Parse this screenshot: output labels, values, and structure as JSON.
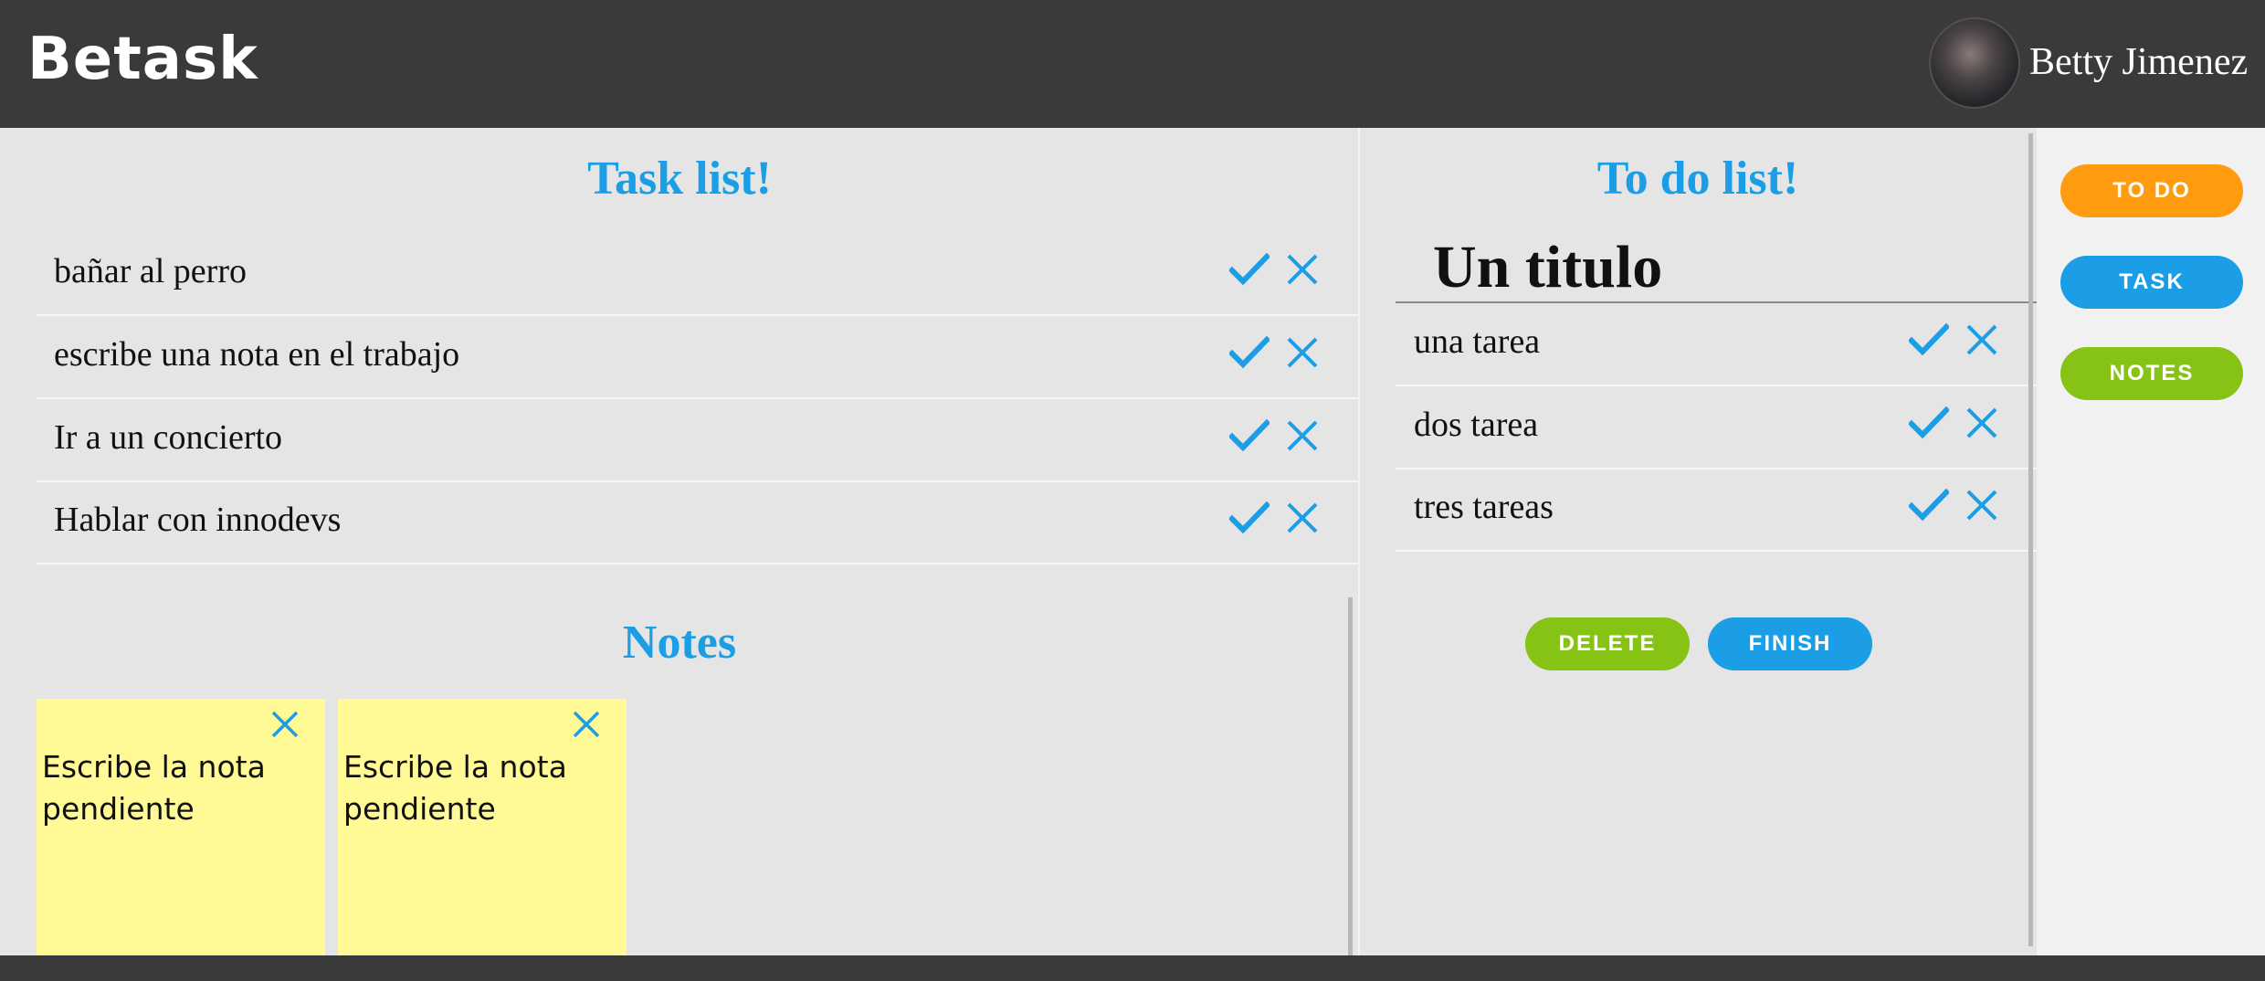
{
  "app": {
    "brand": "Betask"
  },
  "user": {
    "name": "Betty Jimenez"
  },
  "task_list": {
    "title": "Task list!",
    "items": [
      {
        "label": "bañar al perro"
      },
      {
        "label": "escribe una nota en el trabajo"
      },
      {
        "label": "Ir a un concierto"
      },
      {
        "label": "Hablar con innodevs"
      }
    ]
  },
  "notes": {
    "title": "Notes",
    "items": [
      {
        "text": "Escribe la nota pendiente"
      },
      {
        "text": "Escribe la nota pendiente"
      }
    ]
  },
  "todo_list": {
    "title": "To do list!",
    "heading": "Un titulo",
    "items": [
      {
        "label": "una tarea"
      },
      {
        "label": "dos tarea"
      },
      {
        "label": "tres tareas"
      }
    ],
    "delete_label": "DELETE",
    "finish_label": "FINISH"
  },
  "sidebar": {
    "todo_label": "TO DO",
    "task_label": "TASK",
    "notes_label": "NOTES"
  },
  "colors": {
    "accent_blue": "#1b9ee5",
    "accent_orange": "#ff9b0f",
    "accent_green": "#86c315",
    "note_yellow": "#fff996",
    "header_dark": "#3a3a3a"
  }
}
